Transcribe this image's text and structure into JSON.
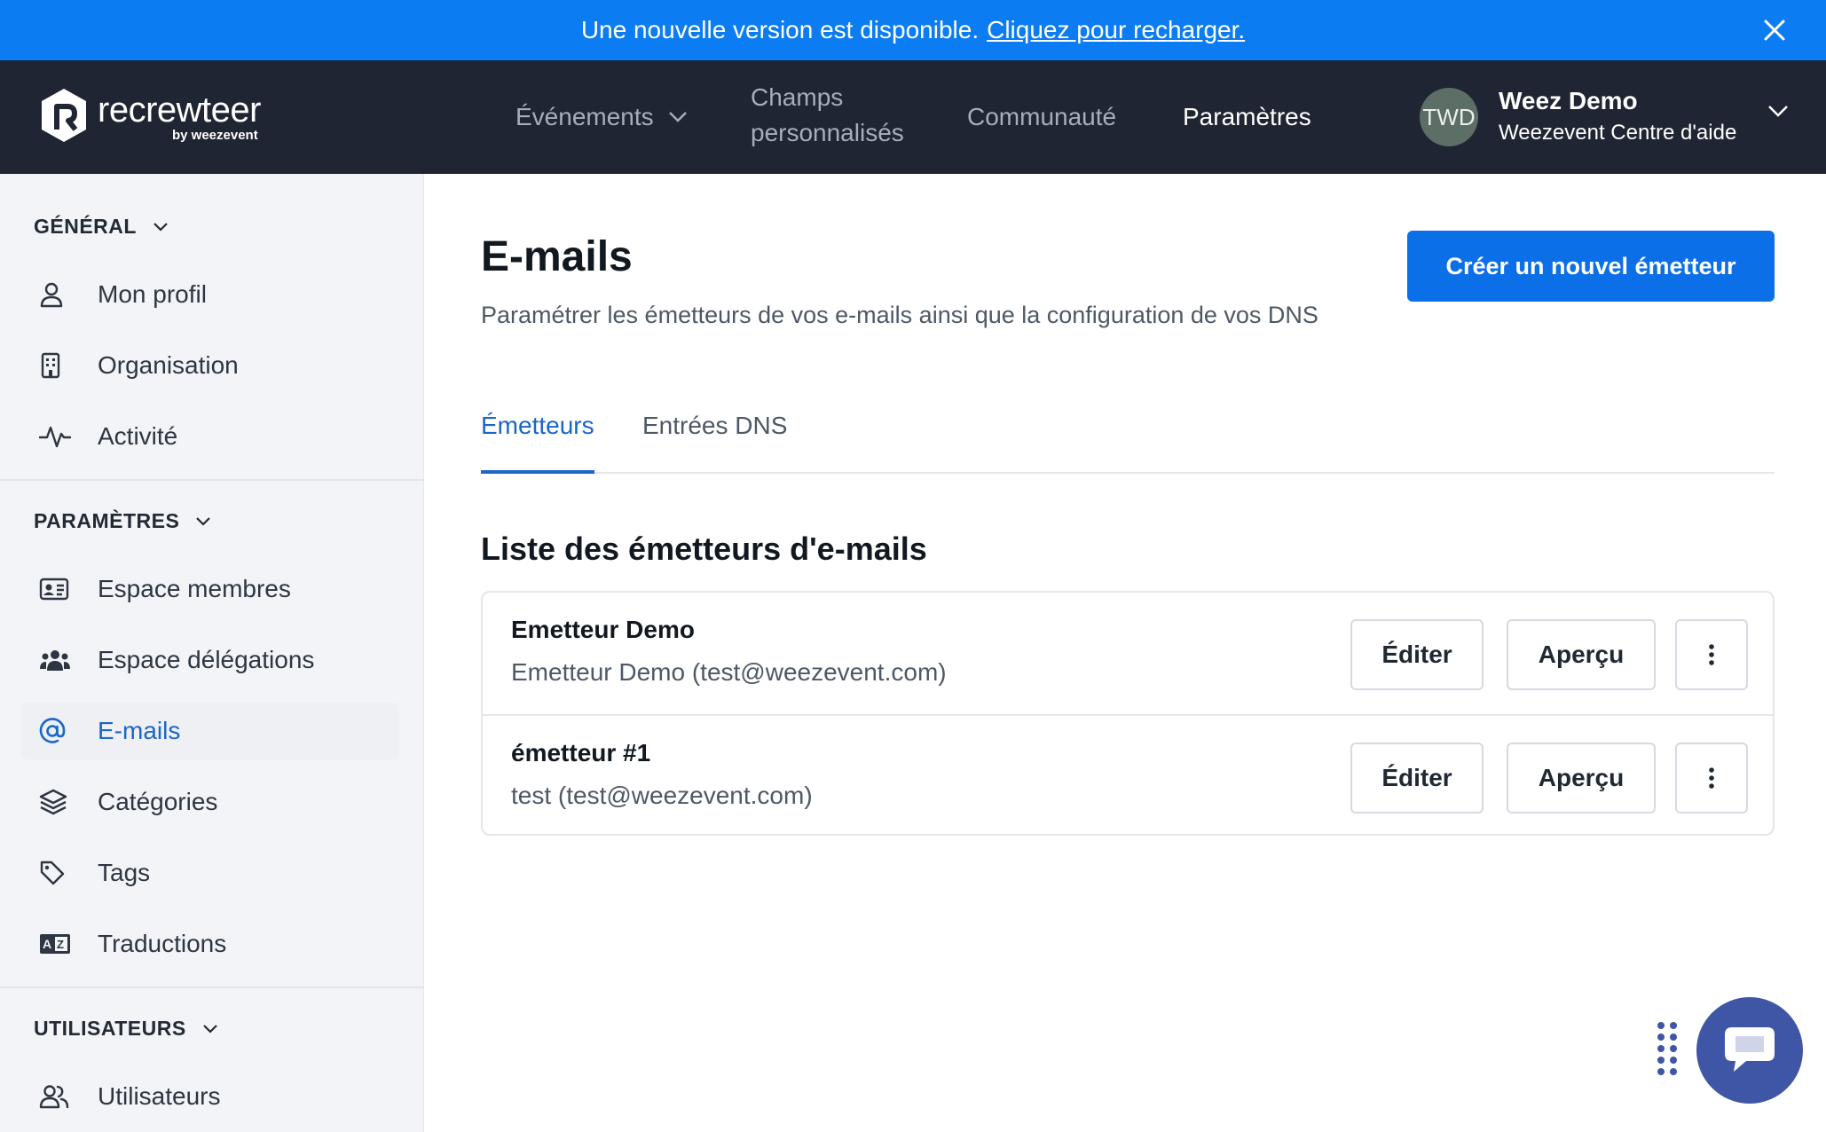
{
  "banner": {
    "message": "Une nouvelle version est disponible.",
    "link": "Cliquez pour recharger."
  },
  "brand": {
    "name": "recrewteer",
    "sub": "by weezevent"
  },
  "nav": {
    "events": "Événements",
    "fields_line1": "Champs",
    "fields_line2": "personnalisés",
    "community": "Communauté",
    "settings": "Paramètres"
  },
  "user": {
    "initials": "TWD",
    "name": "Weez Demo",
    "org": "Weezevent Centre d'aide"
  },
  "sidebar": {
    "general": {
      "title": "GÉNÉRAL",
      "items": [
        {
          "label": "Mon profil",
          "icon": "user-icon"
        },
        {
          "label": "Organisation",
          "icon": "building-icon"
        },
        {
          "label": "Activité",
          "icon": "activity-icon"
        }
      ]
    },
    "settings": {
      "title": "PARAMÈTRES",
      "items": [
        {
          "label": "Espace membres",
          "icon": "id-card-icon"
        },
        {
          "label": "Espace délégations",
          "icon": "users-group-icon"
        },
        {
          "label": "E-mails",
          "icon": "at-icon"
        },
        {
          "label": "Catégories",
          "icon": "layers-icon"
        },
        {
          "label": "Tags",
          "icon": "tag-icon"
        },
        {
          "label": "Traductions",
          "icon": "translate-icon"
        }
      ]
    },
    "users": {
      "title": "UTILISATEURS",
      "items": [
        {
          "label": "Utilisateurs",
          "icon": "users-icon"
        }
      ]
    }
  },
  "main": {
    "title": "E-mails",
    "subtitle": "Paramétrer les émetteurs de vos e-mails ainsi que la configuration de vos DNS",
    "create_button": "Créer un nouvel émetteur",
    "tabs": [
      {
        "label": "Émetteurs",
        "active": true
      },
      {
        "label": "Entrées DNS",
        "active": false
      }
    ],
    "list_title": "Liste des émetteurs d'e-mails",
    "senders": [
      {
        "name": "Emetteur Demo",
        "email": "Emetteur Demo (test@weezevent.com)",
        "edit": "Éditer",
        "preview": "Aperçu"
      },
      {
        "name": "émetteur #1",
        "email": "test (test@weezevent.com)",
        "edit": "Éditer",
        "preview": "Aperçu"
      }
    ]
  },
  "colors": {
    "banner": "#0b7cf2",
    "nav_bg": "#1f2532",
    "accent": "#1a66c9",
    "primary_button": "#0b6fe8",
    "chat_widget": "#3f55a6"
  }
}
